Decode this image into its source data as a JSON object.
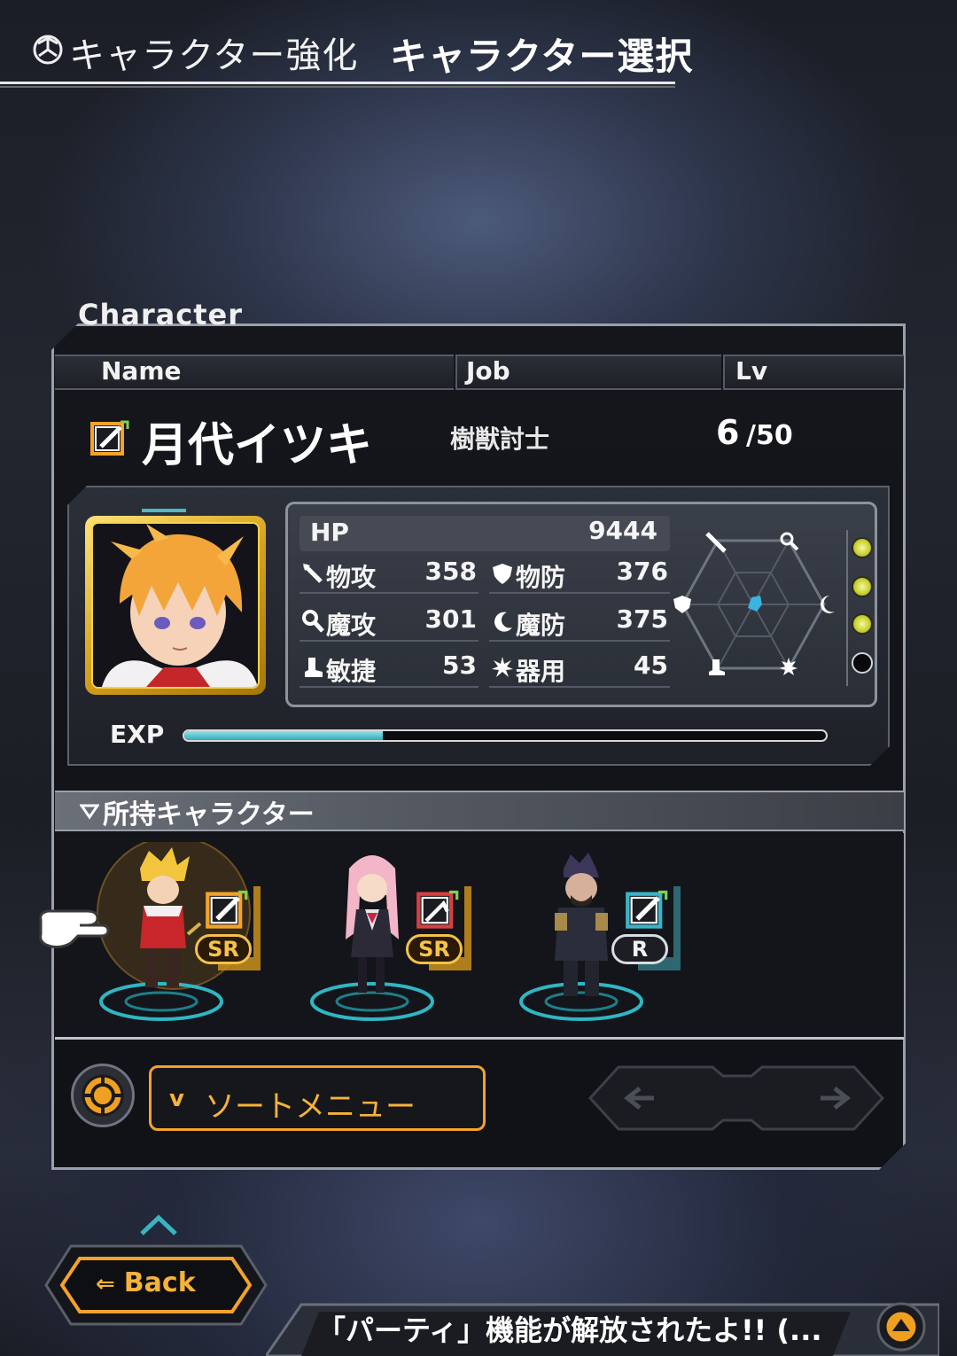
{
  "header": {
    "breadcrumb": "キャラクター強化",
    "title": "キャラクター選択"
  },
  "panel": {
    "label": "Character",
    "columns": {
      "name": "Name",
      "job": "Job",
      "lv": "Lv"
    }
  },
  "character": {
    "name": "月代イツキ",
    "job": "樹獣討士",
    "level": "6",
    "level_max": "/50",
    "exp_label": "EXP",
    "exp_ratio": 0.31,
    "stats": {
      "hp": {
        "label": "HP",
        "value": "9444"
      },
      "patk": {
        "label": "物攻",
        "value": "358"
      },
      "pdef": {
        "label": "物防",
        "value": "376"
      },
      "matk": {
        "label": "魔攻",
        "value": "301"
      },
      "mdef": {
        "label": "魔防",
        "value": "375"
      },
      "agi": {
        "label": "敏捷",
        "value": "53"
      },
      "dex": {
        "label": "器用",
        "value": "45"
      }
    },
    "skill_orbs": [
      "lit",
      "lit",
      "lit",
      "empty"
    ]
  },
  "owned": {
    "title": "所持キャラクター",
    "cards": [
      {
        "rarity": "SR",
        "job_color": "#f4a22a",
        "selected": true
      },
      {
        "rarity": "SR",
        "job_color": "#d64040",
        "selected": false
      },
      {
        "rarity": "R",
        "job_color": "#3ab4c8",
        "selected": false
      }
    ]
  },
  "controls": {
    "sort_prefix": "v",
    "sort_label": "ソートメニュー"
  },
  "back": {
    "label": "Back",
    "arrow": "⇐"
  },
  "ticker": {
    "text": "「パーティ」機能が解放されたよ!! (..."
  },
  "colors": {
    "accent": "#f4a22a",
    "exp": "#37aab5",
    "orb_lit": "#d8e23a"
  }
}
